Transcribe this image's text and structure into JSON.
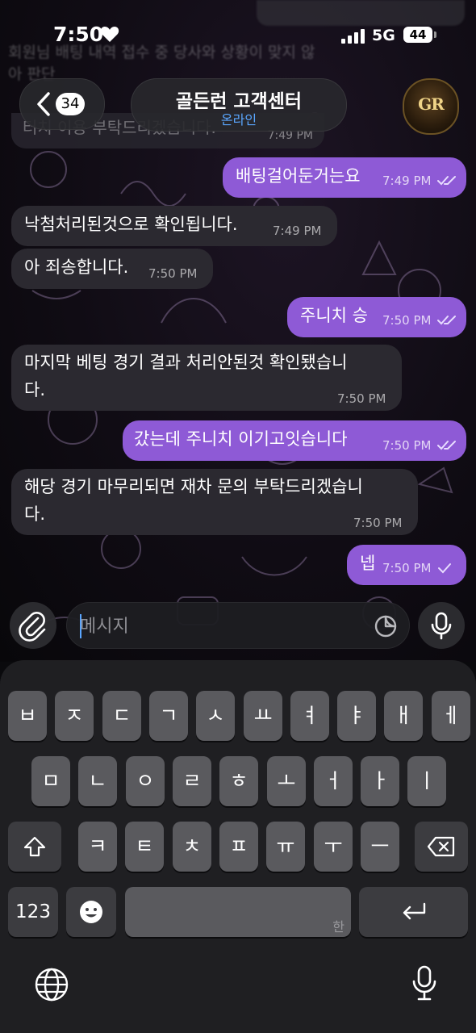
{
  "status_bar": {
    "time": "7:50",
    "network": "5G",
    "battery": "44"
  },
  "header": {
    "unread_count": "34",
    "title": "골든런 고객센터",
    "status": "온라인",
    "avatar_text": "GR"
  },
  "background_hint": {
    "ghost_line1": "회원님 배팅 내역 접수 중 당사와 상황이 맞지 않",
    "ghost_line2": "아 판단",
    "partial_message": "터치 이용 부탁드리겠습니다.",
    "partial_time": "7:49 PM"
  },
  "messages": [
    {
      "dir": "out",
      "text": "배팅걸어둔거는요",
      "time": "7:49 PM",
      "ticks": "double"
    },
    {
      "dir": "in",
      "text": "낙첨처리된것으로 확인됩니다.",
      "time": "7:49 PM"
    },
    {
      "dir": "in",
      "text": "아 죄송합니다.",
      "time": "7:50 PM"
    },
    {
      "dir": "out",
      "text": "주니치 승",
      "time": "7:50 PM",
      "ticks": "double"
    },
    {
      "dir": "in",
      "line1": "마지막 베팅 경기 결과 처리안된것 확인됐습니",
      "line2": "다.",
      "time": "7:50 PM"
    },
    {
      "dir": "out",
      "text": "갔는데 주니치 이기고잇습니다",
      "time": "7:50 PM",
      "ticks": "double"
    },
    {
      "dir": "in",
      "line1": "해당 경기 마무리되면 재차 문의 부탁드리겠습니",
      "line2": "다.",
      "time": "7:50 PM"
    },
    {
      "dir": "out",
      "text": "넵",
      "time": "7:50 PM",
      "ticks": "single"
    }
  ],
  "composer": {
    "placeholder": "메시지"
  },
  "keyboard": {
    "row1": [
      "ㅂ",
      "ㅈ",
      "ㄷ",
      "ㄱ",
      "ㅅ",
      "ㅛ",
      "ㅕ",
      "ㅑ",
      "ㅐ",
      "ㅔ"
    ],
    "row2": [
      "ㅁ",
      "ㄴ",
      "ㅇ",
      "ㄹ",
      "ㅎ",
      "ㅗ",
      "ㅓ",
      "ㅏ",
      "ㅣ"
    ],
    "row3": [
      "ㅋ",
      "ㅌ",
      "ㅊ",
      "ㅍ",
      "ㅠ",
      "ㅜ",
      "ㅡ"
    ],
    "numbers_key": "123",
    "space_label": "한"
  },
  "colors": {
    "outgoing": "#8e5ad6",
    "incoming": "#2b2930",
    "accent": "#5aa6ff"
  },
  "icons": [
    "heart-icon",
    "signal-icon",
    "chevron-left-icon",
    "attach-icon",
    "sticker-icon",
    "mic-icon",
    "shift-icon",
    "backspace-icon",
    "emoji-icon",
    "return-icon",
    "globe-icon",
    "dictation-icon"
  ]
}
